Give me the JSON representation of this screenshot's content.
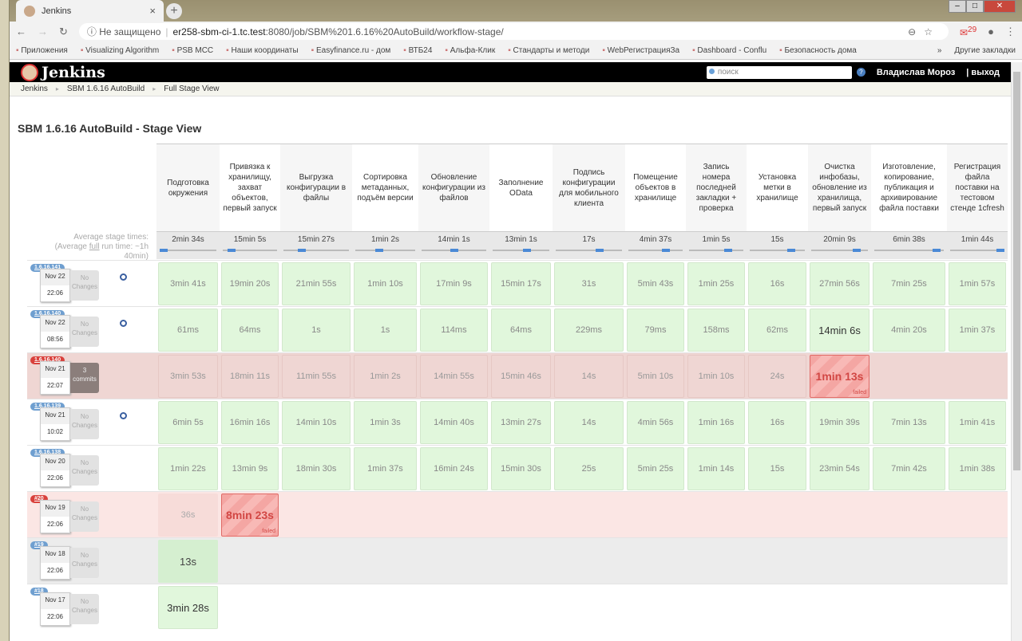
{
  "browser": {
    "tab_title": "Jenkins",
    "security": "Не защищено",
    "url_host": "er258-sbm-ci-1.tc.test",
    "url_path": ":8080/job/SBM%201.6.16%20AutoBuild/workflow-stage/",
    "mail_count": "29",
    "bookmarks": [
      "Приложения",
      "Visualizing Algorithm",
      "PSB MCC",
      "Наши координаты",
      "Easyfinance.ru - дом",
      "ВТБ24",
      "Альфа-Клик",
      "Стандарты и методи",
      "WebРегистрацияЗа",
      "Dashboard - Conflu",
      "Безопасность дома"
    ],
    "other_bookmarks": "Другие закладки"
  },
  "header": {
    "logo": "Jenkins",
    "search_placeholder": "поиск",
    "user": "Владислав Мороз",
    "logout": "| выход"
  },
  "breadcrumbs": [
    "Jenkins",
    "SBM 1.6.16 AutoBuild",
    "Full Stage View"
  ],
  "page_title": "SBM 1.6.16 AutoBuild - Stage View",
  "avg_label": {
    "line1": "Average stage times:",
    "line2a": "(Average ",
    "line2b": "full",
    "line2c": " run time: ~1h",
    "line3": "40min)"
  },
  "stages": [
    {
      "name": "Подготовка окружения",
      "avg": "2min 34s",
      "bar": 0.0
    },
    {
      "name": "Привязка к хранилищу, захват объектов, первый запуск",
      "avg": "15min 5s",
      "bar": 0.1
    },
    {
      "name": "Выгрузка конфигурации в файлы",
      "avg": "15min 27s",
      "bar": 0.25
    },
    {
      "name": "Сортировка метаданных, подъём версии",
      "avg": "1min 2s",
      "bar": 0.38
    },
    {
      "name": "Обновление конфигурации из файлов",
      "avg": "14min 1s",
      "bar": 0.5
    },
    {
      "name": "Заполнение OData",
      "avg": "13min 1s",
      "bar": 0.62
    },
    {
      "name": "Подпись конфигурации для мобильного клиента",
      "avg": "17s",
      "bar": 0.68
    },
    {
      "name": "Помещение объектов в хранилище",
      "avg": "4min 37s",
      "bar": 0.72
    },
    {
      "name": "Запись номера последней закладки + проверка",
      "avg": "1min 5s",
      "bar": 0.76
    },
    {
      "name": "Установка метки в хранилище",
      "avg": "15s",
      "bar": 0.8
    },
    {
      "name": "Очистка инфобазы, обновление из хранилища, первый запуск",
      "avg": "20min 9s",
      "bar": 0.86
    },
    {
      "name": "Изготовление, копирование, публикация и архивирование файла поставки",
      "avg": "6min 38s",
      "bar": 0.95
    },
    {
      "name": "Регистрация файла поставки на тестовом стенде 1cfresh",
      "avg": "1min 44s",
      "bar": 1.0
    }
  ],
  "builds": [
    {
      "id": "1.6.16.141",
      "status": "success",
      "date": "Nov 22",
      "time": "22:06",
      "changes": "No Changes",
      "scheduled": true,
      "cells": [
        "3min 41s",
        "19min 20s",
        "21min 55s",
        "1min 10s",
        "17min 9s",
        "15min 17s",
        "31s",
        "5min 43s",
        "1min 25s",
        "16s",
        "27min 56s",
        "7min 25s",
        "1min 57s"
      ]
    },
    {
      "id": "1.6.16.140",
      "status": "success",
      "date": "Nov 22",
      "time": "08:56",
      "changes": "No Changes",
      "scheduled": true,
      "cells": [
        "61ms",
        "64ms",
        "1s",
        "1s",
        "114ms",
        "64ms",
        "229ms",
        "79ms",
        "158ms",
        "62ms",
        "14min 6s",
        "4min 20s",
        "1min 37s"
      ]
    },
    {
      "id": "1.6.16.140",
      "status": "failed",
      "date": "Nov 21",
      "time": "22:07",
      "changes": "3 commits",
      "scheduled": false,
      "cells": [
        "3min 53s",
        "18min 11s",
        "11min 55s",
        "1min 2s",
        "14min 55s",
        "15min 46s",
        "14s",
        "5min 10s",
        "1min 10s",
        "24s",
        "1min 13s",
        "",
        ""
      ],
      "failed_stage": 10
    },
    {
      "id": "1.6.16.139",
      "status": "success",
      "date": "Nov 21",
      "time": "10:02",
      "changes": "No Changes",
      "scheduled": true,
      "cells": [
        "6min 5s",
        "16min 16s",
        "14min 10s",
        "1min 3s",
        "14min 40s",
        "13min 27s",
        "14s",
        "4min 56s",
        "1min 16s",
        "16s",
        "19min 39s",
        "7min 13s",
        "1min 41s"
      ]
    },
    {
      "id": "1.6.16.138",
      "status": "success",
      "date": "Nov 20",
      "time": "22:06",
      "changes": "No Changes",
      "scheduled": false,
      "cells": [
        "1min 22s",
        "13min 9s",
        "18min 30s",
        "1min 37s",
        "16min 24s",
        "15min 30s",
        "25s",
        "5min 25s",
        "1min 14s",
        "15s",
        "23min 54s",
        "7min 42s",
        "1min 38s"
      ]
    },
    {
      "id": "#20",
      "status": "failed2",
      "date": "Nov 19",
      "time": "22:06",
      "changes": "No Changes",
      "scheduled": false,
      "cells": [
        "36s",
        "8min 23s",
        "",
        "",
        "",
        "",
        "",
        "",
        "",
        "",
        "",
        "",
        ""
      ],
      "failed_stage": 1
    },
    {
      "id": "#19",
      "status": "grey",
      "date": "Nov 18",
      "time": "22:06",
      "changes": "No Changes",
      "scheduled": false,
      "cells": [
        "13s",
        "",
        "",
        "",
        "",
        "",
        "",
        "",
        "",
        "",
        "",
        "",
        ""
      ]
    },
    {
      "id": "#18",
      "status": "success",
      "date": "Nov 17",
      "time": "22:06",
      "changes": "No Changes",
      "scheduled": false,
      "cells": [
        "3min 28s",
        "",
        "",
        "",
        "",
        "",
        "",
        "",
        "",
        "",
        "",
        "",
        ""
      ]
    }
  ],
  "failed_label": "failed"
}
